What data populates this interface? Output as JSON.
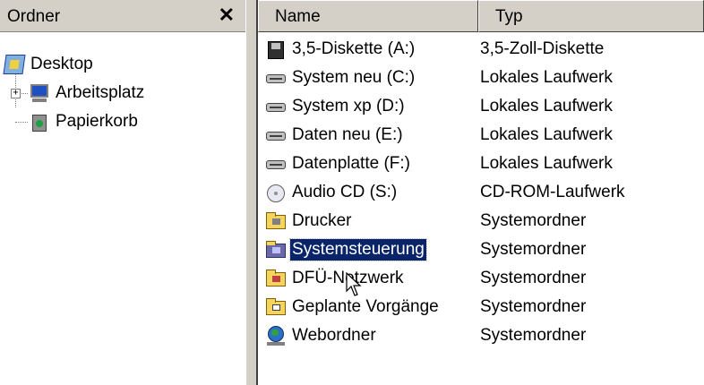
{
  "folders_pane": {
    "title": "Ordner",
    "close_icon": "close-icon",
    "tree": [
      {
        "label": "Desktop",
        "icon": "desktop-icon",
        "level": 0
      },
      {
        "label": "Arbeitsplatz",
        "icon": "computer-icon",
        "level": 1,
        "expander": "+"
      },
      {
        "label": "Papierkorb",
        "icon": "recycle-bin-icon",
        "level": 1
      }
    ]
  },
  "list": {
    "columns": [
      "Name",
      "Typ"
    ],
    "rows": [
      {
        "name": "3,5-Diskette (A:)",
        "type": "3,5-Zoll-Diskette",
        "icon": "floppy-icon"
      },
      {
        "name": "System neu (C:)",
        "type": "Lokales Laufwerk",
        "icon": "hard-drive-icon"
      },
      {
        "name": "System xp (D:)",
        "type": "Lokales Laufwerk",
        "icon": "hard-drive-icon"
      },
      {
        "name": "Daten neu (E:)",
        "type": "Lokales Laufwerk",
        "icon": "hard-drive-icon"
      },
      {
        "name": "Datenplatte (F:)",
        "type": "Lokales Laufwerk",
        "icon": "hard-drive-icon"
      },
      {
        "name": "Audio CD (S:)",
        "type": "CD-ROM-Laufwerk",
        "icon": "cd-icon"
      },
      {
        "name": "Drucker",
        "type": "Systemordner",
        "icon": "printer-folder-icon"
      },
      {
        "name": "Systemsteuerung",
        "type": "Systemordner",
        "icon": "control-panel-icon",
        "selected": true
      },
      {
        "name": "DFÜ-Netzwerk",
        "type": "Systemordner",
        "icon": "dialup-folder-icon"
      },
      {
        "name": "Geplante Vorgänge",
        "type": "Systemordner",
        "icon": "scheduled-tasks-icon"
      },
      {
        "name": "Webordner",
        "type": "Systemordner",
        "icon": "web-folder-icon"
      }
    ]
  },
  "colors": {
    "chrome": "#d4d0c8",
    "selection": "#0a246a",
    "selection_text": "#ffffff"
  }
}
